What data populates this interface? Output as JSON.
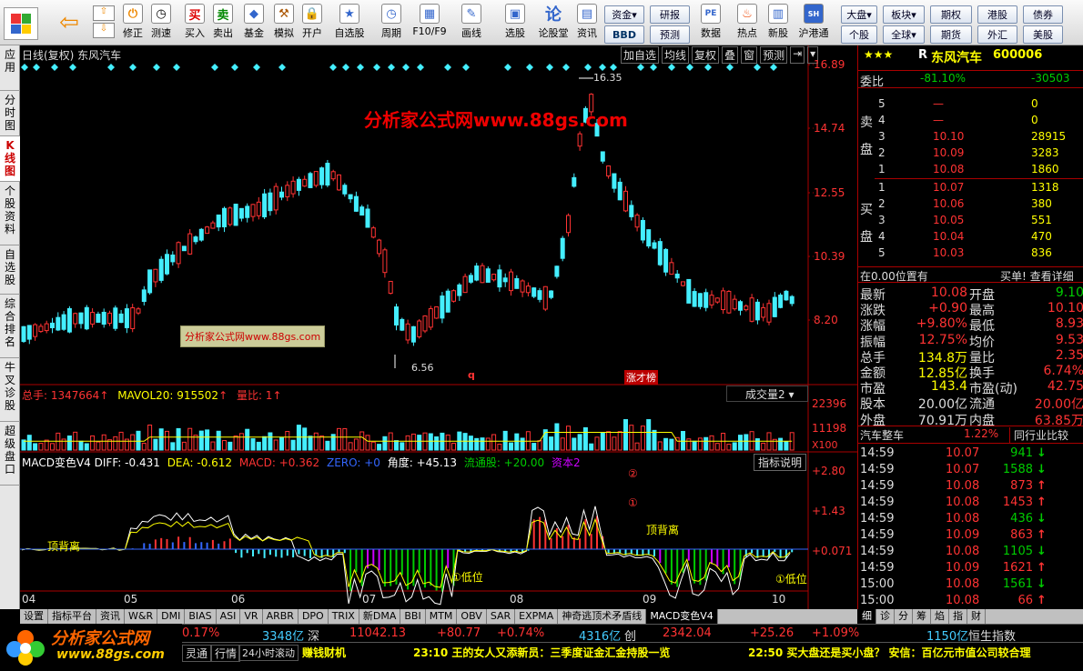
{
  "toolbar": {
    "btn1": "修正",
    "btn2": "测速",
    "btn3": "买入",
    "btn4": "卖出",
    "btn5": "基金",
    "btn6": "模拟",
    "btn7": "开户",
    "btn8": "自选股",
    "btn9": "周期",
    "btn10": "F10/F9",
    "btn11": "画线",
    "btn12": "选股",
    "btn13": "论股堂",
    "btn14": "资讯",
    "btn15": "资金",
    "btn16": "研报",
    "btn17": "BBD",
    "btn18": "预测",
    "btn19": "数据",
    "btn20": "热点",
    "btn21": "新股",
    "btn22": "沪港通",
    "btn23": "大盘",
    "btn24": "板块",
    "btn25": "期权",
    "btn26": "港股",
    "btn27": "债券",
    "btn28": "个股",
    "btn29": "全球",
    "btn30": "期货",
    "btn31": "外汇",
    "btn32": "美股",
    "buy_icon": "买",
    "sell_icon": "卖"
  },
  "sidebar": {
    "items": [
      "应用",
      "分时图",
      "K线图",
      "个股资料",
      "自选股",
      "综合排名",
      "牛叉诊股",
      "超级盘口"
    ]
  },
  "chart": {
    "header": "日线(复权) 东风汽车",
    "buttons": [
      "加自选",
      "均线",
      "复权",
      "叠",
      "窗",
      "预测"
    ],
    "watermark": "分析家公式网www.88gs.com",
    "watermark_small": "分析家公式网www.88gs.com",
    "y_labels": [
      "16.89",
      "14.74",
      "12.55",
      "10.39",
      "8.20"
    ],
    "high_label": "16.35",
    "low_label": "6.56",
    "q_mark": "q",
    "zhang_label": "涨才榜",
    "vol_header": {
      "total": "总手: 1347664",
      "mavol": "MAVOL20: 915502",
      "ratio": "量比: 1"
    },
    "vol_select": "成交量2",
    "vol_labels": [
      "22396",
      "11198",
      "X100"
    ],
    "macd_header": {
      "name": "MACD变色V4",
      "diff": "DIFF: -0.431",
      "dea": "DEA: -0.612",
      "macd": "MACD: +0.362",
      "zero": "ZERO: +0",
      "angle": "角度: +45.13",
      "flow": "流通股: +20.00",
      "cap": "资本2"
    },
    "macd_explain": "指标说明",
    "macd_labels": [
      "+2.80",
      "+1.43",
      "+0.071"
    ],
    "circle2": "②",
    "circle1": "①",
    "top_div1": "顶背离",
    "top_div2": "顶背离",
    "low1": "①低位",
    "low2": "①低位",
    "x_labels": [
      "04",
      "05",
      "06",
      "07",
      "08",
      "09",
      "10"
    ]
  },
  "bottom_tabs": [
    "设置",
    "指标平台",
    "资讯",
    "W&R",
    "DMI",
    "BIAS",
    "ASI",
    "VR",
    "ARBR",
    "DPO",
    "TRIX",
    "新DMA",
    "BBI",
    "MTM",
    "OBV",
    "SAR",
    "EXPMA",
    "神奇逃顶术矛盾线",
    "MACD变色V4"
  ],
  "right": {
    "stars": "★★★",
    "code_prefix": "R",
    "name": "东风汽车",
    "code": "600006",
    "weibi_label": "委比",
    "weibi": "-81.10%",
    "weicha": "-30503",
    "sell_label": "卖盘",
    "buy_label": "买盘",
    "asks": [
      {
        "lv": "5",
        "p": "—",
        "v": "0"
      },
      {
        "lv": "4",
        "p": "—",
        "v": "0"
      },
      {
        "lv": "3",
        "p": "10.10",
        "v": "28915"
      },
      {
        "lv": "2",
        "p": "10.09",
        "v": "3283"
      },
      {
        "lv": "1",
        "p": "10.08",
        "v": "1860"
      }
    ],
    "bids": [
      {
        "lv": "1",
        "p": "10.07",
        "v": "1318"
      },
      {
        "lv": "2",
        "p": "10.06",
        "v": "380"
      },
      {
        "lv": "3",
        "p": "10.05",
        "v": "551"
      },
      {
        "lv": "4",
        "p": "10.04",
        "v": "470"
      },
      {
        "lv": "5",
        "p": "10.03",
        "v": "836"
      }
    ],
    "pos_text": "在0.00位置有",
    "pos_right": "买单! 查看详细",
    "stats": [
      [
        "最新",
        "10.08",
        "开盘",
        "9.10"
      ],
      [
        "涨跌",
        "+0.90",
        "最高",
        "10.10"
      ],
      [
        "涨幅",
        "+9.80%",
        "最低",
        "8.93"
      ],
      [
        "振幅",
        "12.75%",
        "均价",
        "9.53"
      ],
      [
        "总手",
        "134.8万",
        "量比",
        "2.35"
      ],
      [
        "金额",
        "12.85亿",
        "换手",
        "6.74%"
      ],
      [
        "市盈",
        "143.4",
        "市盈(动)",
        "42.75"
      ],
      [
        "股本",
        "20.00亿",
        "流通",
        "20.00亿"
      ],
      [
        "外盘",
        "70.91万",
        "内盘",
        "63.85万"
      ]
    ],
    "industry": "汽车整车",
    "industry_pct": "1.22%",
    "industry_btn": "同行业比较",
    "ticks": [
      [
        "14:59",
        "10.07",
        "941"
      ],
      [
        "14:59",
        "10.07",
        "1588"
      ],
      [
        "14:59",
        "10.08",
        "873"
      ],
      [
        "14:59",
        "10.08",
        "1453"
      ],
      [
        "14:59",
        "10.08",
        "436"
      ],
      [
        "14:59",
        "10.09",
        "863"
      ],
      [
        "14:59",
        "10.08",
        "1105"
      ],
      [
        "14:59",
        "10.09",
        "1621"
      ],
      [
        "15:00",
        "10.08",
        "1561"
      ],
      [
        "15:00",
        "10.08",
        "66"
      ]
    ],
    "tick_dirs": [
      "down",
      "down",
      "up",
      "up",
      "down",
      "up",
      "down",
      "up",
      "down",
      "up"
    ],
    "tabs": [
      "细",
      "诊",
      "分",
      "筹",
      "焰",
      "指",
      "财"
    ]
  },
  "ticker": {
    "t1": "0.17%",
    "t2": "3348亿",
    "t3": "深",
    "t4": "11042.13",
    "t5": "+80.77",
    "t6": "+0.74%",
    "t7": "4316亿",
    "t8": "创",
    "t9": "2342.04",
    "t10": "+25.26",
    "t11": "+1.09%",
    "t12": "1150亿",
    "t13": "恒生指数"
  },
  "news": {
    "n0": "灵通",
    "n1": "行情",
    "n2": "24小时滚动",
    "n3": "赚钱财机",
    "n4": "23:10 王的女人又添新员：三季度证金汇金持股一览",
    "n5": "22:50 买大盘还是买小盘？ 安信：百亿元市值公司较合理"
  },
  "logo": {
    "text": "分析家公式网",
    "url": "www.88gs.com"
  }
}
